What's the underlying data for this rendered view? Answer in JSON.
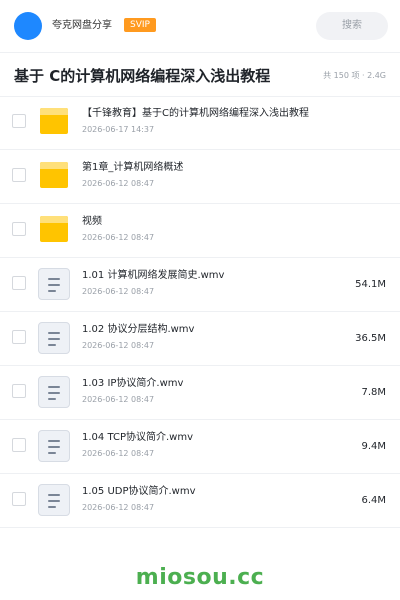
{
  "header": {
    "app_name": "夸克网盘分享",
    "badge": "SVIP",
    "search_placeholder": "搜索"
  },
  "title": {
    "text": "基于 C的计算机网络编程深入浅出教程",
    "summary": "共 150 项 · 2.4G"
  },
  "files": [
    {
      "type": "folder",
      "name": "【千锋教育】基于C的计算机网络编程深入浅出教程",
      "date": "2026-06-17 14:37",
      "size": ""
    },
    {
      "type": "folder",
      "name": "第1章_计算机网络概述",
      "date": "2026-06-12 08:47",
      "size": ""
    },
    {
      "type": "folder",
      "name": "视频",
      "date": "2026-06-12 08:47",
      "size": ""
    },
    {
      "type": "file",
      "name": "1.01 计算机网络发展简史.wmv",
      "date": "2026-06-12 08:47",
      "size": "54.1M"
    },
    {
      "type": "file",
      "name": "1.02 协议分层结构.wmv",
      "date": "2026-06-12 08:47",
      "size": "36.5M"
    },
    {
      "type": "file",
      "name": "1.03 IP协议简介.wmv",
      "date": "2026-06-12 08:47",
      "size": "7.8M"
    },
    {
      "type": "file",
      "name": "1.04 TCP协议简介.wmv",
      "date": "2026-06-12 08:47",
      "size": "9.4M"
    },
    {
      "type": "file",
      "name": "1.05 UDP协议简介.wmv",
      "date": "2026-06-12 08:47",
      "size": "6.4M"
    }
  ],
  "watermark": "miosou.cc",
  "colors": {
    "accent": "#1e88ff",
    "svip": "#ff9a1f",
    "folder": "#ffc400",
    "watermark": "#4caf50"
  }
}
